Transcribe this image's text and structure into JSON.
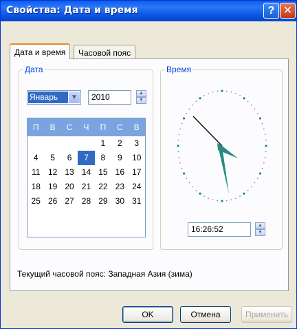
{
  "window": {
    "title": "Свойства: Дата и время",
    "help_label": "?",
    "close_label": "✕"
  },
  "tabs": [
    {
      "label": "Дата и время"
    },
    {
      "label": "Часовой пояс"
    }
  ],
  "date_group": {
    "label": "Дата",
    "month_value": "Январь",
    "year_value": "2010",
    "weekdays": [
      "П",
      "В",
      "С",
      "Ч",
      "П",
      "С",
      "В"
    ],
    "weeks": [
      [
        "",
        "",
        "",
        "",
        "1",
        "2",
        "3"
      ],
      [
        "4",
        "5",
        "6",
        "7",
        "8",
        "9",
        "10"
      ],
      [
        "11",
        "12",
        "13",
        "14",
        "15",
        "16",
        "17"
      ],
      [
        "18",
        "19",
        "20",
        "21",
        "22",
        "23",
        "24"
      ],
      [
        "25",
        "26",
        "27",
        "28",
        "29",
        "30",
        "31"
      ]
    ],
    "selected_day": "7"
  },
  "time_group": {
    "label": "Время",
    "time_value": "16:26:52"
  },
  "timezone_text": "Текущий часовой пояс: Западная Азия (зима)",
  "buttons": {
    "ok": "OK",
    "cancel": "Отмена",
    "apply": "Применить"
  },
  "colors": {
    "title_bar": "#0a5ef0",
    "selection": "#316ac5",
    "calendar_header": "#7aa4e0",
    "clock_hands": "#2a8a80"
  },
  "icons": {
    "help": "question-icon",
    "close": "close-icon"
  }
}
